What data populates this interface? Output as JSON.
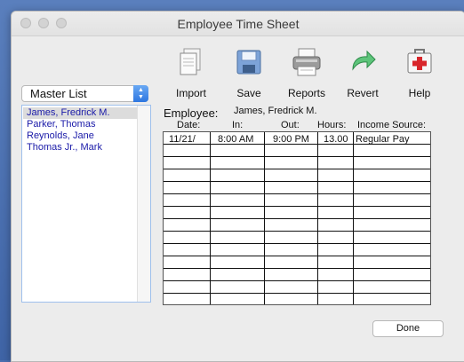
{
  "window": {
    "title": "Employee Time Sheet"
  },
  "toolbar": {
    "import_label": "Import",
    "save_label": "Save",
    "reports_label": "Reports",
    "revert_label": "Revert",
    "help_label": "Help"
  },
  "sidebar": {
    "popup_value": "Master List",
    "items": [
      {
        "label": "James, Fredrick M."
      },
      {
        "label": "Parker, Thomas"
      },
      {
        "label": "Reynolds, Jane"
      },
      {
        "label": "Thomas Jr., Mark"
      }
    ]
  },
  "employee": {
    "label": "Employee:",
    "name": "James, Fredrick M."
  },
  "columns": {
    "date": "Date:",
    "in": "In:",
    "out": "Out:",
    "hours": "Hours:",
    "income": "Income Source:"
  },
  "rows": [
    {
      "date": "11/21/",
      "in": "8:00 AM",
      "out": "9:00 PM",
      "hours": "13.00",
      "income": "Regular Pay"
    }
  ],
  "done_label": "Done",
  "colors": {
    "accent": "#2d76e0",
    "list_text": "#1a1aa8"
  }
}
